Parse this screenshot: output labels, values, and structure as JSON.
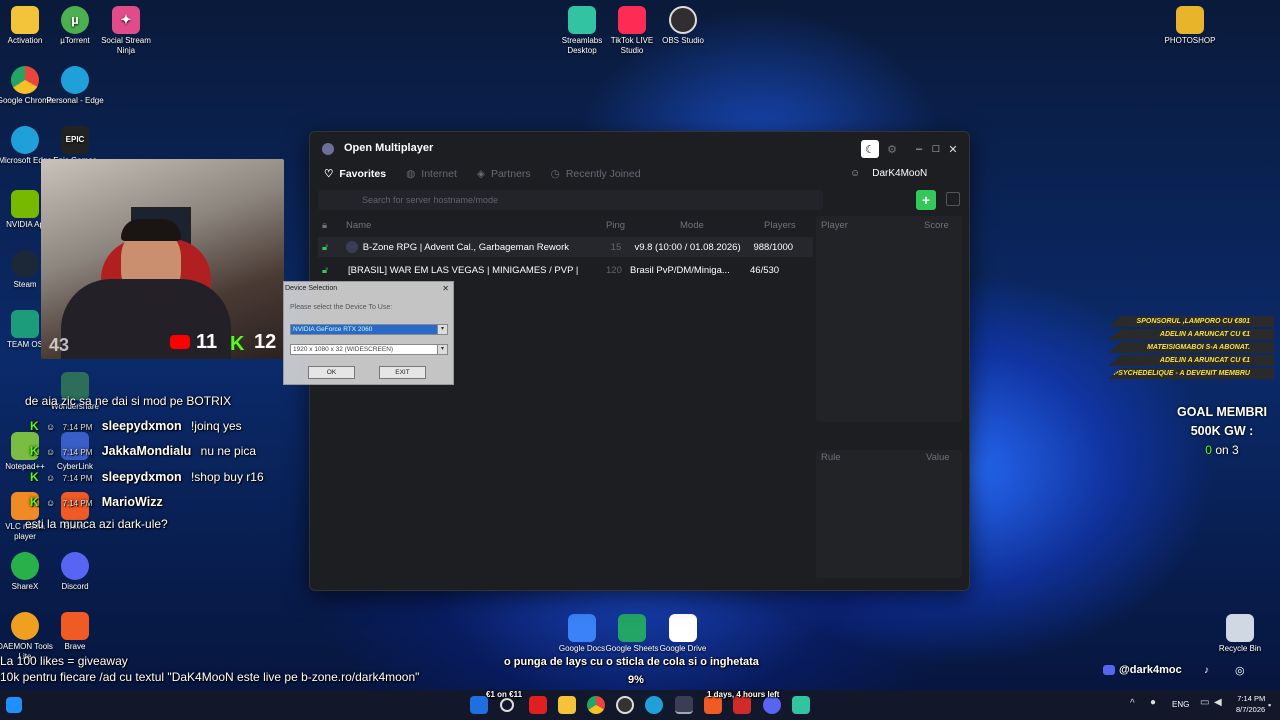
{
  "desktop_icons": [
    {
      "label": "Activation",
      "color": "#f3c33a"
    },
    {
      "label": "µTorrent",
      "color": "#4caf50"
    },
    {
      "label": "Social Stream Ninja",
      "color": "#e04b8a"
    },
    {
      "label": "Google Chrome",
      "color": "#e8453c"
    },
    {
      "label": "Personal - Edge",
      "color": "#1fa0d8"
    },
    {
      "label": "Microsoft Edge",
      "color": "#1fa0d8"
    },
    {
      "label": "Epic Games",
      "color": "#222222"
    },
    {
      "label": "NVIDIA Ap",
      "color": "#76b900"
    },
    {
      "label": "Steam",
      "color": "#1b2838"
    },
    {
      "label": "TEAM OS",
      "color": "#1c9c7a"
    },
    {
      "label": "Wondershare",
      "color": "#2c6e5a"
    },
    {
      "label": "CyberLink",
      "color": "#3a5ec8"
    },
    {
      "label": "Notepad++",
      "color": "#7bbd42"
    },
    {
      "label": "VLC media player",
      "color": "#f08a24"
    },
    {
      "label": "Brave",
      "color": "#f05a24"
    },
    {
      "label": "ShareX",
      "color": "#2ab04a"
    },
    {
      "label": "Discord",
      "color": "#5865f2"
    },
    {
      "label": "DAEMON Tools Lite",
      "color": "#f0a020"
    },
    {
      "label": "Brave",
      "color": "#f05a24"
    },
    {
      "label": "Streamlabs Desktop",
      "color": "#31c3a2"
    },
    {
      "label": "TikTok LIVE Studio",
      "color": "#fe2c55"
    },
    {
      "label": "OBS Studio",
      "color": "#302e31"
    },
    {
      "label": "PHOTOSHOP",
      "color": "#e8b52a"
    },
    {
      "label": "Google Docs",
      "color": "#3b82f6"
    },
    {
      "label": "Google Sheets",
      "color": "#23a566"
    },
    {
      "label": "Google Drive",
      "color": "#ffffff"
    },
    {
      "label": "Recycle Bin",
      "color": "#cfd8e3"
    }
  ],
  "window": {
    "title": "Open Multiplayer",
    "tabs": [
      "Favorites",
      "Internet",
      "Partners",
      "Recently Joined"
    ],
    "user": "DarK4MooN",
    "search_placeholder": "Search for server hostname/mode",
    "columns": {
      "name": "Name",
      "ping": "Ping",
      "mode": "Mode",
      "players": "Players",
      "player": "Player",
      "score": "Score",
      "rule": "Rule",
      "value": "Value"
    },
    "servers": [
      {
        "name": "B-Zone RPG | Advent Cal., Garbageman Rework",
        "ping": "15",
        "mode": "v9.8 (10:00 / 01.08.2026)",
        "players": "988/1000"
      },
      {
        "name": "[BRASIL] WAR EM LAS VEGAS | MINIGAMES / PVP |",
        "ping": "120",
        "mode": "Brasil PvP/DM/Miniga...",
        "players": "46/530"
      }
    ]
  },
  "dialog": {
    "title": "Device Selection",
    "prompt": "Please select the Device To Use:",
    "device": "NVIDIA GeForce RTX 2060",
    "resolution": "1920 x 1080 x 32 (WIDESCREEN)",
    "ok": "OK",
    "exit": "EXIT"
  },
  "webcam": {
    "viewer_count": "43",
    "youtube_count": "11",
    "kick_count": "12"
  },
  "chat": [
    {
      "text": "de aia zic sa ne dai si mod pe BOTRIX"
    },
    {
      "time": "7:14 PM",
      "user": "sleepydxmon",
      "msg": "!joinq yes"
    },
    {
      "time": "7:14 PM",
      "user": "JakkaMondialu",
      "msg": "nu ne pica"
    },
    {
      "time": "7:14 PM",
      "user": "sleepydxmon",
      "msg": "!shop buy r16"
    },
    {
      "time": "7:14 PM",
      "user": "MarioWizz",
      "msg": ""
    },
    {
      "text": "esti la munca azi dark-ule?"
    }
  ],
  "alerts": [
    "SPONSORUL ,LAMPORO CU €801",
    "ADELIN A ARUNCAT CU €1",
    "MATEISIGMABOI S-A ABONAT.",
    "ADELIN A ARUNCAT CU €1",
    "PSYCHEDELIQUE - A DEVENIT MEMBRU"
  ],
  "goal": {
    "line1": "GOAL MEMBRI",
    "line2": "500K GW :",
    "count": "0",
    "suffix": "on 3"
  },
  "bottom_overlay": {
    "line1": "La 100 likes = giveaway",
    "line2": "10k pentru fiecare /ad cu textul \"DaK4MooN este live pe b-zone.ro/dark4moon\"",
    "center_text": "o punga de lays cu o sticla de cola si o inghetata",
    "percent": "9%",
    "donation": "€1 on €11",
    "countdown": "1 days, 4 hours left",
    "handle": "@dark4moc"
  },
  "taskbar": {
    "lang": "ENG",
    "time": "7:14 PM",
    "date": "8/7/2026"
  }
}
